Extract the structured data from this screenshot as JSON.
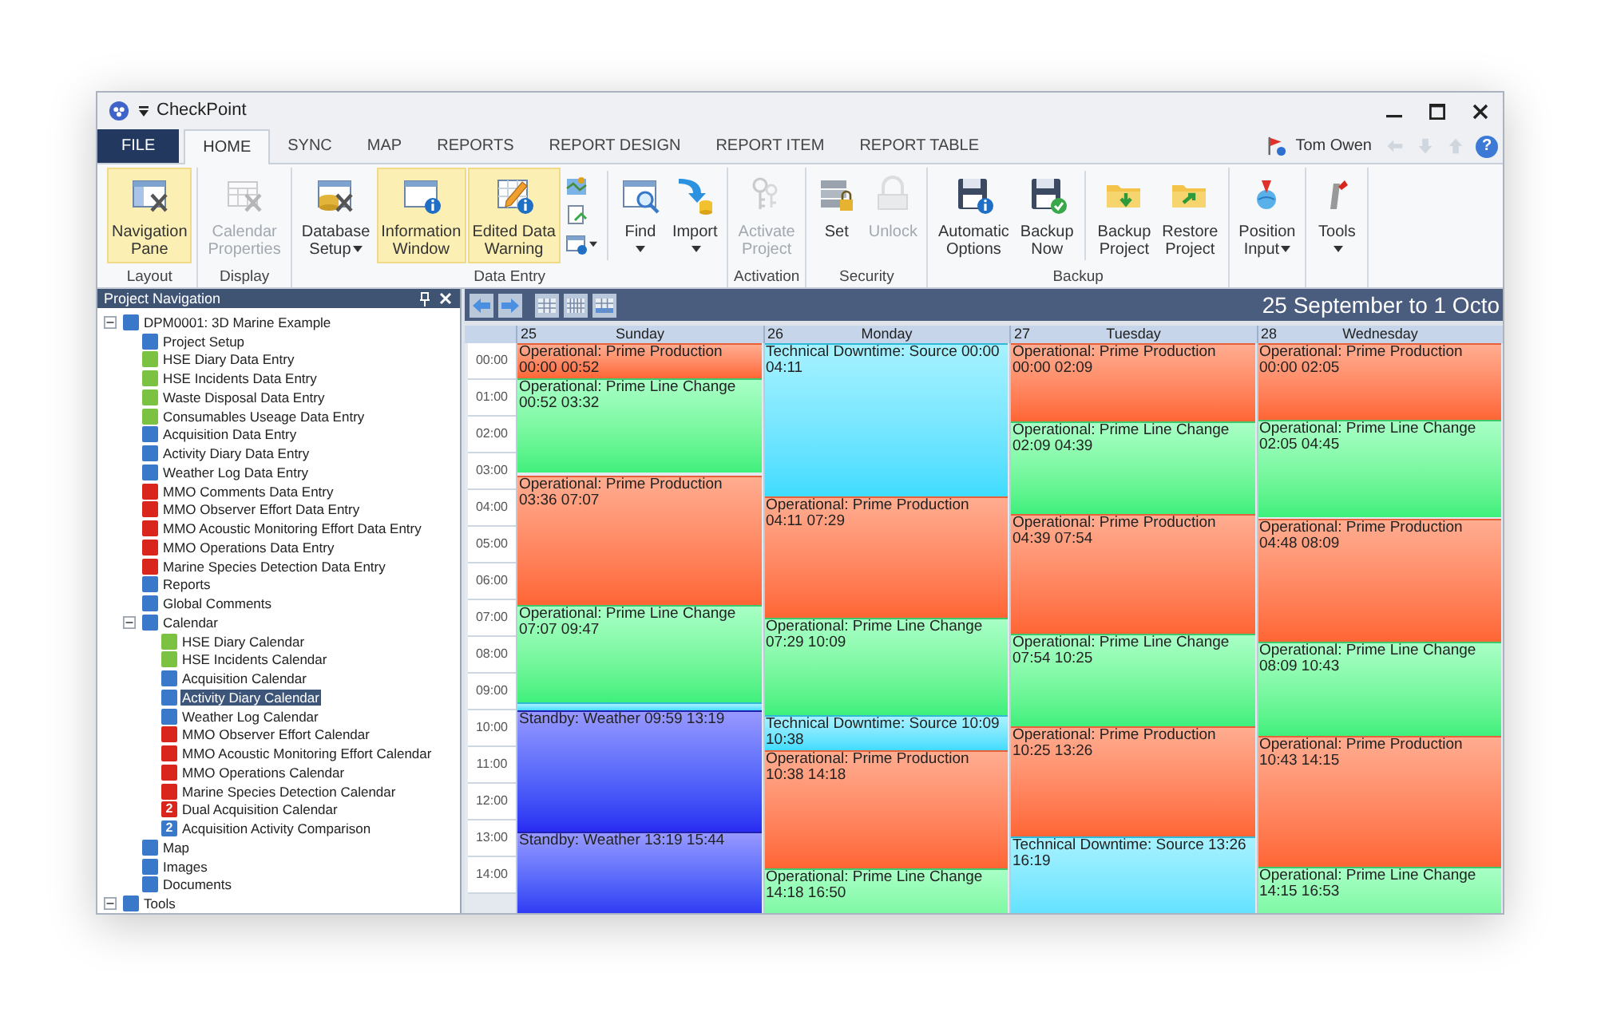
{
  "window": {
    "title": "CheckPoint"
  },
  "ribbon_tabs": [
    {
      "label": "FILE",
      "kind": "file",
      "selected": false
    },
    {
      "label": "HOME",
      "kind": "tab",
      "selected": true
    },
    {
      "label": "SYNC",
      "kind": "tab",
      "selected": false
    },
    {
      "label": "MAP",
      "kind": "tab",
      "selected": false
    },
    {
      "label": "REPORTS",
      "kind": "tab",
      "selected": false
    },
    {
      "label": "REPORT DESIGN",
      "kind": "tab",
      "selected": false
    },
    {
      "label": "REPORT ITEM",
      "kind": "tab",
      "selected": false
    },
    {
      "label": "REPORT TABLE",
      "kind": "tab",
      "selected": false
    }
  ],
  "user": {
    "name": "Tom Owen",
    "help_glyph": "?"
  },
  "ribbon_groups": [
    {
      "label": "Layout",
      "items": [
        {
          "kind": "button",
          "label_lines": [
            "Navigation",
            "Pane"
          ],
          "highlighted": true,
          "disabled": false,
          "dropdown": false
        }
      ]
    },
    {
      "label": "Display",
      "items": [
        {
          "kind": "button",
          "label_lines": [
            "Calendar",
            "Properties"
          ],
          "highlighted": false,
          "disabled": true,
          "dropdown": false
        }
      ]
    },
    {
      "label": "Data Entry",
      "items": [
        {
          "kind": "button",
          "label_lines": [
            "Database",
            "Setup"
          ],
          "highlighted": false,
          "disabled": false,
          "dropdown": true
        },
        {
          "kind": "button",
          "label_lines": [
            "Information",
            "Window"
          ],
          "highlighted": true,
          "disabled": false,
          "dropdown": false
        },
        {
          "kind": "button",
          "label_lines": [
            "Edited Data",
            "Warning"
          ],
          "highlighted": true,
          "disabled": false,
          "dropdown": false
        },
        {
          "kind": "icon_stack"
        },
        {
          "kind": "separator"
        },
        {
          "kind": "button",
          "label_lines": [
            "Find"
          ],
          "highlighted": false,
          "disabled": false,
          "dropdown": true
        },
        {
          "kind": "button",
          "label_lines": [
            "Import"
          ],
          "highlighted": false,
          "disabled": false,
          "dropdown": true
        }
      ]
    },
    {
      "label": "Activation",
      "items": [
        {
          "kind": "button",
          "label_lines": [
            "Activate",
            "Project"
          ],
          "highlighted": false,
          "disabled": true,
          "dropdown": false
        }
      ]
    },
    {
      "label": "Security",
      "items": [
        {
          "kind": "button",
          "label_lines": [
            "Set"
          ],
          "highlighted": false,
          "disabled": false,
          "dropdown": false
        },
        {
          "kind": "button",
          "label_lines": [
            "Unlock"
          ],
          "highlighted": false,
          "disabled": true,
          "dropdown": false
        }
      ]
    },
    {
      "label": "Backup",
      "items": [
        {
          "kind": "button",
          "label_lines": [
            "Automatic",
            "Options"
          ],
          "highlighted": false,
          "disabled": false,
          "dropdown": false
        },
        {
          "kind": "button",
          "label_lines": [
            "Backup",
            "Now"
          ],
          "highlighted": false,
          "disabled": false,
          "dropdown": false
        },
        {
          "kind": "separator"
        },
        {
          "kind": "button",
          "label_lines": [
            "Backup",
            "Project"
          ],
          "highlighted": false,
          "disabled": false,
          "dropdown": false
        },
        {
          "kind": "button",
          "label_lines": [
            "Restore",
            "Project"
          ],
          "highlighted": false,
          "disabled": false,
          "dropdown": false
        }
      ]
    },
    {
      "items": [
        {
          "kind": "button",
          "label_lines": [
            "Position",
            "Input"
          ],
          "highlighted": false,
          "disabled": false,
          "dropdown": true
        }
      ]
    },
    {
      "items": [
        {
          "kind": "button",
          "label_lines": [
            "Tools"
          ],
          "highlighted": false,
          "disabled": false,
          "dropdown": true
        }
      ]
    }
  ],
  "navigation": {
    "title": "Project Navigation",
    "tree": [
      {
        "label": "DPM0001: 3D Marine Example",
        "color": "#3a78c9",
        "selected": false,
        "expanded": true,
        "children": [
          {
            "label": "Project Setup",
            "color": "#3a78c9",
            "selected": false
          },
          {
            "label": "HSE Diary Data Entry",
            "color": "#7cc242",
            "selected": false
          },
          {
            "label": "HSE Incidents Data Entry",
            "color": "#7cc242",
            "selected": false
          },
          {
            "label": "Waste Disposal Data Entry",
            "color": "#7cc242",
            "selected": false
          },
          {
            "label": "Consumables Useage Data Entry",
            "color": "#7cc242",
            "selected": false
          },
          {
            "label": "Acquisition Data Entry",
            "color": "#3a78c9",
            "selected": false
          },
          {
            "label": "Activity Diary Data Entry",
            "color": "#3a78c9",
            "selected": false
          },
          {
            "label": "Weather Log Data Entry",
            "color": "#3a78c9",
            "selected": false
          },
          {
            "label": "MMO Comments Data Entry",
            "color": "#d9261c",
            "selected": false
          },
          {
            "label": "MMO Observer Effort Data Entry",
            "color": "#d9261c",
            "selected": false
          },
          {
            "label": "MMO Acoustic Monitoring Effort Data Entry",
            "color": "#d9261c",
            "selected": false
          },
          {
            "label": "MMO Operations Data Entry",
            "color": "#d9261c",
            "selected": false
          },
          {
            "label": "Marine Species Detection Data Entry",
            "color": "#d9261c",
            "selected": false
          },
          {
            "label": "Reports",
            "color": "#3a78c9",
            "selected": false
          },
          {
            "label": "Global Comments",
            "color": "#3a78c9",
            "selected": false
          },
          {
            "label": "Calendar",
            "color": "#3a78c9",
            "selected": false,
            "expanded": true,
            "children": [
              {
                "label": "HSE Diary Calendar",
                "color": "#7cc242",
                "selected": false
              },
              {
                "label": "HSE Incidents Calendar",
                "color": "#7cc242",
                "selected": false
              },
              {
                "label": "Acquisition Calendar",
                "color": "#3a78c9",
                "selected": false
              },
              {
                "label": "Activity Diary Calendar",
                "color": "#3a78c9",
                "selected": true
              },
              {
                "label": "Weather Log Calendar",
                "color": "#3a78c9",
                "selected": false
              },
              {
                "label": "MMO Observer Effort Calendar",
                "color": "#d9261c",
                "selected": false
              },
              {
                "label": "MMO Acoustic Monitoring Effort Calendar",
                "color": "#d9261c",
                "selected": false
              },
              {
                "label": "MMO Operations Calendar",
                "color": "#d9261c",
                "selected": false
              },
              {
                "label": "Marine Species Detection Calendar",
                "color": "#d9261c",
                "selected": false
              },
              {
                "label": "Dual Acquisition Calendar",
                "color": "#d9261c",
                "selected": false,
                "icon_text": "2"
              },
              {
                "label": "Acquisition Activity Comparison",
                "color": "#3a78c9",
                "selected": false,
                "icon_text": "2"
              }
            ]
          },
          {
            "label": "Map",
            "color": "#3a78c9",
            "selected": false
          },
          {
            "label": "Images",
            "color": "#3a78c9",
            "selected": false
          },
          {
            "label": "Documents",
            "color": "#3a78c9",
            "selected": false
          }
        ]
      },
      {
        "label": "Tools",
        "color": "#3a78c9",
        "selected": false,
        "expanded": true
      }
    ]
  },
  "calendar": {
    "title": "25 September to 1 Octo",
    "time_slots": [
      "00:00",
      "01:00",
      "02:00",
      "03:00",
      "04:00",
      "05:00",
      "06:00",
      "07:00",
      "08:00",
      "09:00",
      "10:00",
      "11:00",
      "12:00",
      "13:00",
      "14:00"
    ],
    "days": [
      {
        "date": "25",
        "day": "Sunday",
        "events": [
          {
            "kind": "production",
            "start": "00:00",
            "end": "00:52",
            "label": "Operational: Prime Production"
          },
          {
            "kind": "line_change",
            "start": "00:52",
            "end": "03:32",
            "label": "Operational: Prime Line Change"
          },
          {
            "kind": "production",
            "start": "03:36",
            "end": "07:07",
            "label": "Operational: Prime Production"
          },
          {
            "kind": "line_change",
            "start": "07:07",
            "end": "09:47",
            "label": "Operational: Prime Line Change"
          },
          {
            "kind": "downtime"
          },
          {
            "kind": "standby",
            "start": "09:59",
            "end": "13:19",
            "label": "Standby: Weather"
          },
          {
            "kind": "standby",
            "start": "13:19",
            "end": "15:44",
            "label": "Standby: Weather"
          }
        ]
      },
      {
        "date": "26",
        "day": "Monday",
        "events": [
          {
            "kind": "downtime",
            "start": "00:00",
            "end": "04:11",
            "label": "Technical Downtime: Source"
          },
          {
            "kind": "production",
            "start": "04:11",
            "end": "07:29",
            "label": "Operational: Prime Production"
          },
          {
            "kind": "line_change",
            "start": "07:29",
            "end": "10:09",
            "label": "Operational: Prime Line Change"
          },
          {
            "kind": "downtime",
            "start": "10:09",
            "end": "10:38",
            "label": "Technical Downtime: Source"
          },
          {
            "kind": "production",
            "start": "10:38",
            "end": "14:18",
            "label": "Operational: Prime Production"
          },
          {
            "kind": "line_change",
            "start": "14:18",
            "end": "16:50",
            "label": "Operational: Prime Line Change"
          }
        ]
      },
      {
        "date": "27",
        "day": "Tuesday",
        "events": [
          {
            "kind": "production",
            "start": "00:00",
            "end": "02:09",
            "label": "Operational: Prime Production"
          },
          {
            "kind": "line_change",
            "start": "02:09",
            "end": "04:39",
            "label": "Operational: Prime Line Change"
          },
          {
            "kind": "production",
            "start": "04:39",
            "end": "07:54",
            "label": "Operational: Prime Production"
          },
          {
            "kind": "line_change",
            "start": "07:54",
            "end": "10:25",
            "label": "Operational: Prime Line Change"
          },
          {
            "kind": "production",
            "start": "10:25",
            "end": "13:26",
            "label": "Operational: Prime Production"
          },
          {
            "kind": "downtime",
            "start": "13:26",
            "end": "16:19",
            "label": "Technical Downtime: Source"
          }
        ]
      },
      {
        "date": "28",
        "day": "Wednesday",
        "events": [
          {
            "kind": "production",
            "start": "00:00",
            "end": "02:05",
            "label": "Operational: Prime Production"
          },
          {
            "kind": "line_change",
            "start": "02:05",
            "end": "04:45",
            "label": "Operational: Prime Line Change"
          },
          {
            "kind": "production",
            "start": "04:48",
            "end": "08:09",
            "label": "Operational: Prime Production"
          },
          {
            "kind": "line_change",
            "start": "08:09",
            "end": "10:43",
            "label": "Operational: Prime Line Change"
          },
          {
            "kind": "production",
            "start": "10:43",
            "end": "14:15",
            "label": "Operational: Prime Production"
          },
          {
            "kind": "line_change",
            "start": "14:15",
            "end": "16:53",
            "label": "Operational: Prime Line Change"
          }
        ]
      }
    ]
  }
}
